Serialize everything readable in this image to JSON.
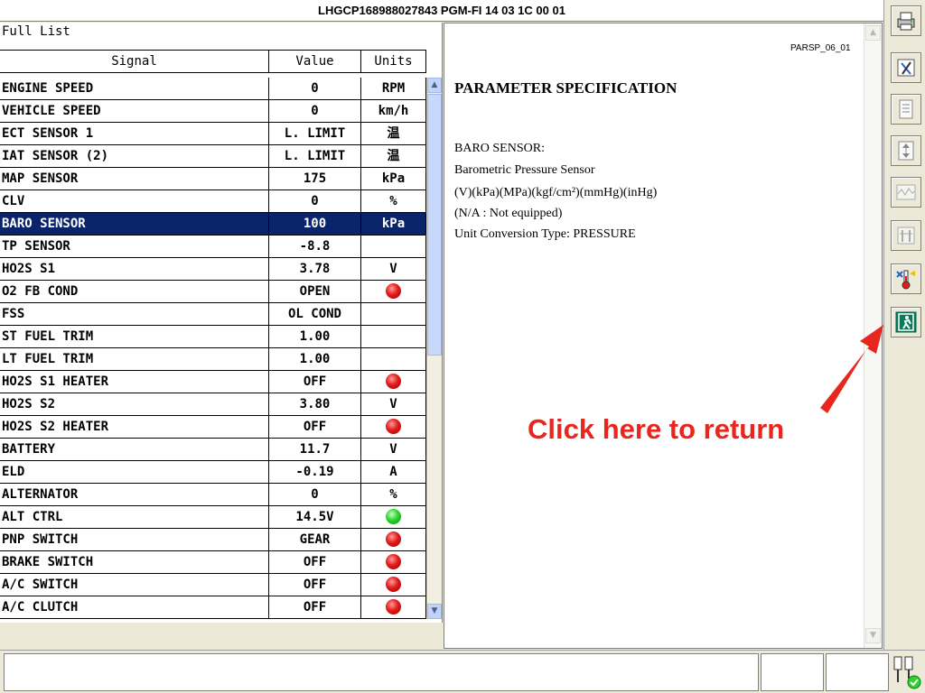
{
  "window": {
    "title": "LHGCP168988027843  PGM-FI  14 03 1C 00 01"
  },
  "list": {
    "title": "Full List",
    "columns": {
      "signal": "Signal",
      "value": "Value",
      "units": "Units"
    },
    "rows": [
      {
        "signal": "ENGINE SPEED",
        "value": "0",
        "units": "RPM"
      },
      {
        "signal": "VEHICLE SPEED",
        "value": "0",
        "units": "km/h"
      },
      {
        "signal": "ECT SENSOR 1",
        "value": "L. LIMIT",
        "units": "温"
      },
      {
        "signal": "IAT SENSOR (2)",
        "value": "L. LIMIT",
        "units": "温"
      },
      {
        "signal": "MAP SENSOR",
        "value": "175",
        "units": "kPa"
      },
      {
        "signal": "CLV",
        "value": "0",
        "units": "%"
      },
      {
        "signal": "BARO SENSOR",
        "value": "100",
        "units": "kPa",
        "selected": true
      },
      {
        "signal": "TP SENSOR",
        "value": "-8.8",
        "units": ""
      },
      {
        "signal": "HO2S S1",
        "value": "3.78",
        "units": "V"
      },
      {
        "signal": "O2 FB COND",
        "value": "OPEN",
        "units": "",
        "indicator": "red"
      },
      {
        "signal": "FSS",
        "value": "OL COND",
        "units": ""
      },
      {
        "signal": "ST FUEL TRIM",
        "value": "1.00",
        "units": ""
      },
      {
        "signal": "LT FUEL TRIM",
        "value": "1.00",
        "units": ""
      },
      {
        "signal": "HO2S S1 HEATER",
        "value": "OFF",
        "units": "",
        "indicator": "red"
      },
      {
        "signal": "HO2S S2",
        "value": "3.80",
        "units": "V"
      },
      {
        "signal": "HO2S S2 HEATER",
        "value": "OFF",
        "units": "",
        "indicator": "red"
      },
      {
        "signal": "BATTERY",
        "value": "11.7",
        "units": "V"
      },
      {
        "signal": "ELD",
        "value": "-0.19",
        "units": "A"
      },
      {
        "signal": "ALTERNATOR",
        "value": "0",
        "units": "%"
      },
      {
        "signal": "ALT CTRL",
        "value": "14.5V",
        "units": "",
        "indicator": "green"
      },
      {
        "signal": "PNP SWITCH",
        "value": "GEAR",
        "units": "",
        "indicator": "red"
      },
      {
        "signal": "BRAKE SWITCH",
        "value": "OFF",
        "units": "",
        "indicator": "red"
      },
      {
        "signal": "A/C SWITCH",
        "value": "OFF",
        "units": "",
        "indicator": "red"
      },
      {
        "signal": "A/C CLUTCH",
        "value": "OFF",
        "units": "",
        "indicator": "red"
      }
    ]
  },
  "doc": {
    "code": "PARSP_06_01",
    "heading": "PARAMETER SPECIFICATION",
    "lines": [
      "BARO SENSOR:",
      "Barometric Pressure Sensor",
      "(V)(kPa)(MPa)(kgf/cm²)(mmHg)(inHg)",
      "(N/A : Not equipped)",
      "Unit Conversion Type: PRESSURE"
    ]
  },
  "callout": {
    "text": "Click here to return"
  },
  "colors": {
    "selection": "#0a246a",
    "callout": "#e8261d",
    "led_red": "#e21b1b",
    "led_green": "#2fd32f"
  },
  "toolbar": {
    "icons": [
      "printer-icon",
      "tools-icon",
      "document-icon",
      "updown-icon",
      "waveform-icon",
      "settings-icon",
      "thermometer-icon",
      "exit-icon"
    ]
  },
  "status": {
    "connector_icon": "connector-ok-icon"
  }
}
